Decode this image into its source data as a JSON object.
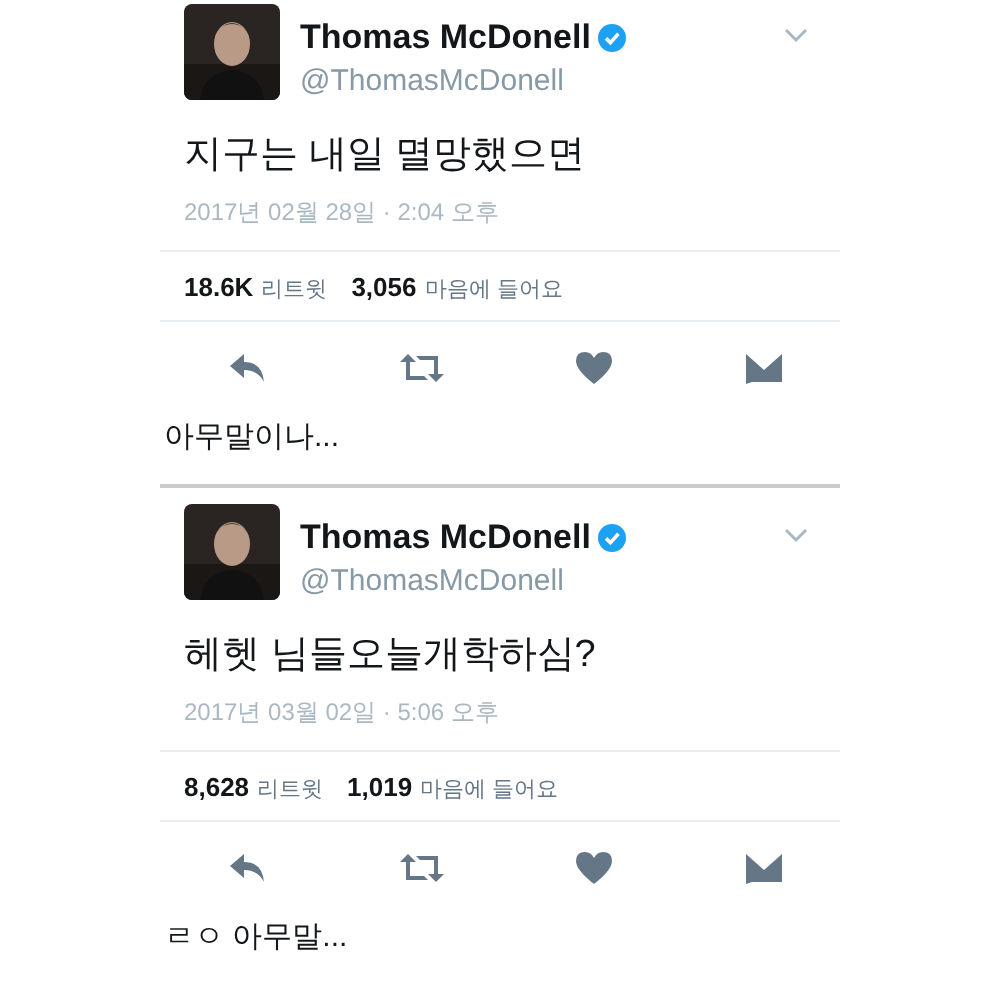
{
  "tweets": [
    {
      "display_name": "Thomas McDonell",
      "verified": true,
      "handle": "@ThomasMcDonell",
      "text": "지구는 내일 멸망했으면",
      "timestamp": "2017년 02월 28일 · 2:04 오후",
      "retweets_count": "18.6K",
      "retweets_label": "리트윗",
      "likes_count": "3,056",
      "likes_label": "마음에 들어요",
      "caption": "아무말이나..."
    },
    {
      "display_name": "Thomas McDonell",
      "verified": true,
      "handle": "@ThomasMcDonell",
      "text": "헤헷 님들오늘개학하심?",
      "timestamp": "2017년 03월 02일 · 5:06 오후",
      "retweets_count": "8,628",
      "retweets_label": "리트윗",
      "likes_count": "1,019",
      "likes_label": "마음에 들어요",
      "caption": "ㄹㅇ 아무말..."
    }
  ]
}
